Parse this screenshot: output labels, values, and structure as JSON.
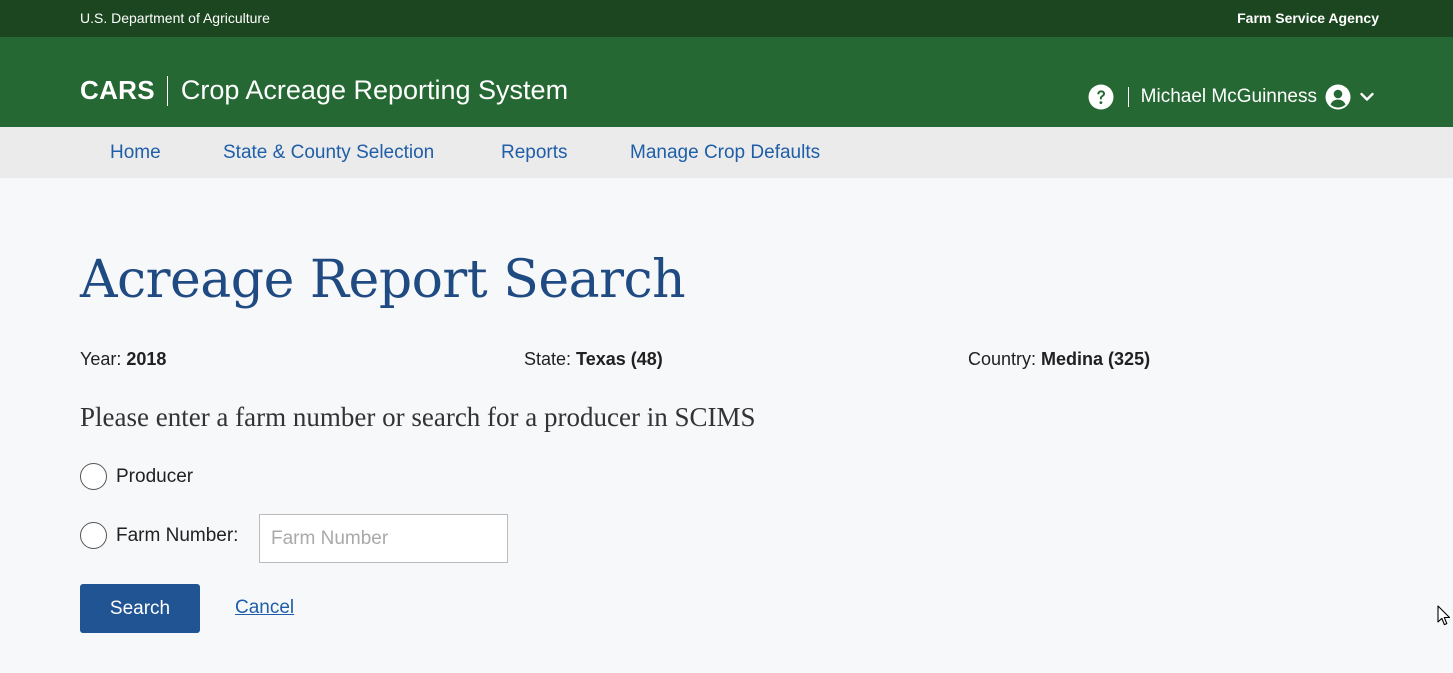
{
  "topbar": {
    "department": "U.S. Department of Agriculture",
    "agency": "Farm Service Agency"
  },
  "header": {
    "app_abbr": "CARS",
    "app_name": "Crop Acreage Reporting System",
    "user_name": "Michael McGuinness",
    "help_icon": "question-circle-icon",
    "avatar_icon": "user-circle-icon",
    "menu_icon": "chevron-down-icon"
  },
  "nav": {
    "items": [
      {
        "label": "Home"
      },
      {
        "label": "State & County Selection"
      },
      {
        "label": "Reports"
      },
      {
        "label": "Manage Crop Defaults"
      }
    ]
  },
  "main": {
    "title": "Acreage Report Search",
    "year_label": "Year:",
    "year_value": "2018",
    "state_label": "State:",
    "state_value": "Texas (48)",
    "county_label": "Country:",
    "county_value": "Medina (325)",
    "prompt": "Please enter a farm number or search for a producer in SCIMS",
    "radio_producer_label": "Producer",
    "radio_farm_label": "Farm Number:",
    "farm_input_placeholder": "Farm Number",
    "farm_input_value": "",
    "search_button": "Search",
    "cancel_link": "Cancel"
  },
  "colors": {
    "topbar": "#1b4620",
    "header": "#256833",
    "nav_bg": "#ebebeb",
    "link": "#1f5ea8",
    "title": "#1f4a82",
    "primary_button": "#205493"
  }
}
